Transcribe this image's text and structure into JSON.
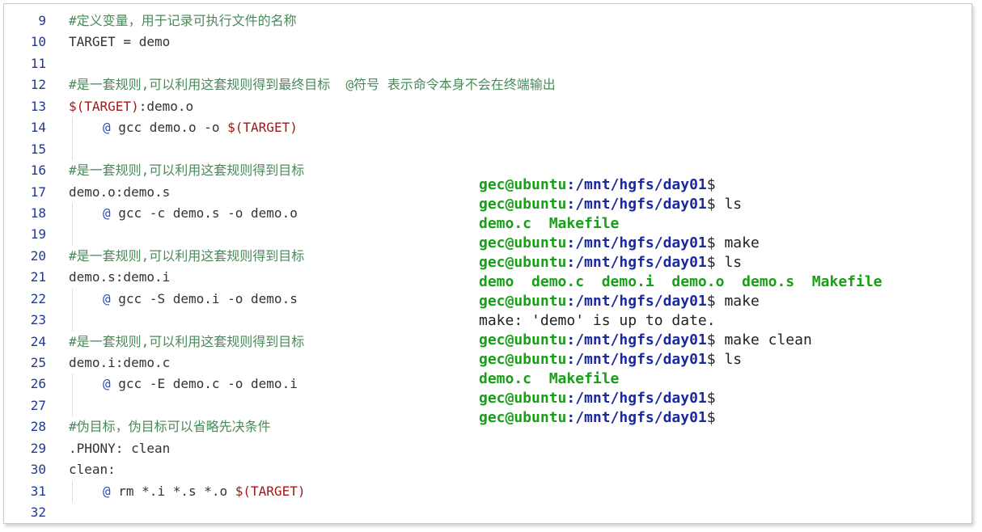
{
  "editor": {
    "lines": [
      {
        "num": "9",
        "indent": false,
        "parts": [
          {
            "t": "#定义变量，用于记录可执行文件的名称",
            "c": "comment"
          }
        ]
      },
      {
        "num": "10",
        "indent": false,
        "parts": [
          {
            "t": "TARGET = demo",
            "c": ""
          }
        ]
      },
      {
        "num": "11",
        "indent": false,
        "parts": []
      },
      {
        "num": "12",
        "indent": false,
        "parts": [
          {
            "t": "#是一套规则,可以利用这套规则得到最终目标  @符号 表示命令本身不会在终端输出",
            "c": "comment"
          }
        ]
      },
      {
        "num": "13",
        "indent": false,
        "parts": [
          {
            "t": "$(TARGET)",
            "c": "var"
          },
          {
            "t": ":demo.o",
            "c": ""
          }
        ]
      },
      {
        "num": "14",
        "indent": true,
        "parts": [
          {
            "t": "@",
            "c": "at"
          },
          {
            "t": " gcc demo.o -o ",
            "c": ""
          },
          {
            "t": "$(TARGET)",
            "c": "var"
          }
        ]
      },
      {
        "num": "15",
        "indent": true,
        "parts": []
      },
      {
        "num": "16",
        "indent": false,
        "parts": [
          {
            "t": "#是一套规则,可以利用这套规则得到目标",
            "c": "comment"
          }
        ]
      },
      {
        "num": "17",
        "indent": false,
        "parts": [
          {
            "t": "demo.o:demo.s",
            "c": ""
          }
        ]
      },
      {
        "num": "18",
        "indent": true,
        "parts": [
          {
            "t": "@",
            "c": "at"
          },
          {
            "t": " gcc -c demo.s -o demo.o",
            "c": ""
          }
        ]
      },
      {
        "num": "19",
        "indent": true,
        "parts": []
      },
      {
        "num": "20",
        "indent": false,
        "parts": [
          {
            "t": "#是一套规则,可以利用这套规则得到目标",
            "c": "comment"
          }
        ]
      },
      {
        "num": "21",
        "indent": false,
        "parts": [
          {
            "t": "demo.s:demo.i",
            "c": ""
          }
        ]
      },
      {
        "num": "22",
        "indent": true,
        "parts": [
          {
            "t": "@",
            "c": "at"
          },
          {
            "t": " gcc -S demo.i -o demo.s",
            "c": ""
          }
        ]
      },
      {
        "num": "23",
        "indent": true,
        "parts": []
      },
      {
        "num": "24",
        "indent": false,
        "parts": [
          {
            "t": "#是一套规则,可以利用这套规则得到目标",
            "c": "comment"
          }
        ]
      },
      {
        "num": "25",
        "indent": false,
        "parts": [
          {
            "t": "demo.i:demo.c",
            "c": ""
          }
        ]
      },
      {
        "num": "26",
        "indent": true,
        "parts": [
          {
            "t": "@",
            "c": "at"
          },
          {
            "t": " gcc -E demo.c -o demo.i",
            "c": ""
          }
        ]
      },
      {
        "num": "27",
        "indent": true,
        "parts": []
      },
      {
        "num": "28",
        "indent": false,
        "parts": [
          {
            "t": "#伪目标，伪目标可以省略先决条件",
            "c": "comment"
          }
        ]
      },
      {
        "num": "29",
        "indent": false,
        "parts": [
          {
            "t": ".PHONY: clean",
            "c": ""
          }
        ]
      },
      {
        "num": "30",
        "indent": false,
        "parts": [
          {
            "t": "clean:",
            "c": ""
          }
        ]
      },
      {
        "num": "31",
        "indent": true,
        "parts": [
          {
            "t": "@",
            "c": "at"
          },
          {
            "t": " rm *.i *.s *.o ",
            "c": ""
          },
          {
            "t": "$(TARGET)",
            "c": "var"
          }
        ]
      },
      {
        "num": "32",
        "indent": false,
        "parts": []
      }
    ]
  },
  "terminal": {
    "lines": [
      [
        {
          "t": "gec@ubuntu",
          "c": "user"
        },
        {
          "t": ":/mnt/hgfs/day01",
          "c": "path"
        },
        {
          "t": "$",
          "c": "plain"
        }
      ],
      [
        {
          "t": "gec@ubuntu",
          "c": "user"
        },
        {
          "t": ":/mnt/hgfs/day01",
          "c": "path"
        },
        {
          "t": "$ ls",
          "c": "plain"
        }
      ],
      [
        {
          "t": "demo.c  Makefile",
          "c": "file"
        }
      ],
      [
        {
          "t": "gec@ubuntu",
          "c": "user"
        },
        {
          "t": ":/mnt/hgfs/day01",
          "c": "path"
        },
        {
          "t": "$ make",
          "c": "plain"
        }
      ],
      [
        {
          "t": "gec@ubuntu",
          "c": "user"
        },
        {
          "t": ":/mnt/hgfs/day01",
          "c": "path"
        },
        {
          "t": "$ ls",
          "c": "plain"
        }
      ],
      [
        {
          "t": "demo  demo.c  demo.i  demo.o  demo.s  Makefile",
          "c": "file"
        }
      ],
      [
        {
          "t": "gec@ubuntu",
          "c": "user"
        },
        {
          "t": ":/mnt/hgfs/day01",
          "c": "path"
        },
        {
          "t": "$ make",
          "c": "plain"
        }
      ],
      [
        {
          "t": "make: 'demo' is up to date.",
          "c": "plain"
        }
      ],
      [
        {
          "t": "gec@ubuntu",
          "c": "user"
        },
        {
          "t": ":/mnt/hgfs/day01",
          "c": "path"
        },
        {
          "t": "$ make clean",
          "c": "plain"
        }
      ],
      [
        {
          "t": "gec@ubuntu",
          "c": "user"
        },
        {
          "t": ":/mnt/hgfs/day01",
          "c": "path"
        },
        {
          "t": "$ ls",
          "c": "plain"
        }
      ],
      [
        {
          "t": "demo.c  Makefile",
          "c": "file"
        }
      ],
      [
        {
          "t": "gec@ubuntu",
          "c": "user"
        },
        {
          "t": ":/mnt/hgfs/day01",
          "c": "path"
        },
        {
          "t": "$",
          "c": "plain"
        }
      ],
      [
        {
          "t": "gec@ubuntu",
          "c": "user"
        },
        {
          "t": ":/mnt/hgfs/day01",
          "c": "path"
        },
        {
          "t": "$",
          "c": "plain"
        }
      ]
    ]
  },
  "colors": {
    "line_number": "#1f3a93",
    "comment": "#4a8a5a",
    "variable": "#a01818",
    "at_symbol": "#2a4fb5",
    "terminal_user": "#16a016",
    "terminal_path": "#1a2aa0"
  }
}
